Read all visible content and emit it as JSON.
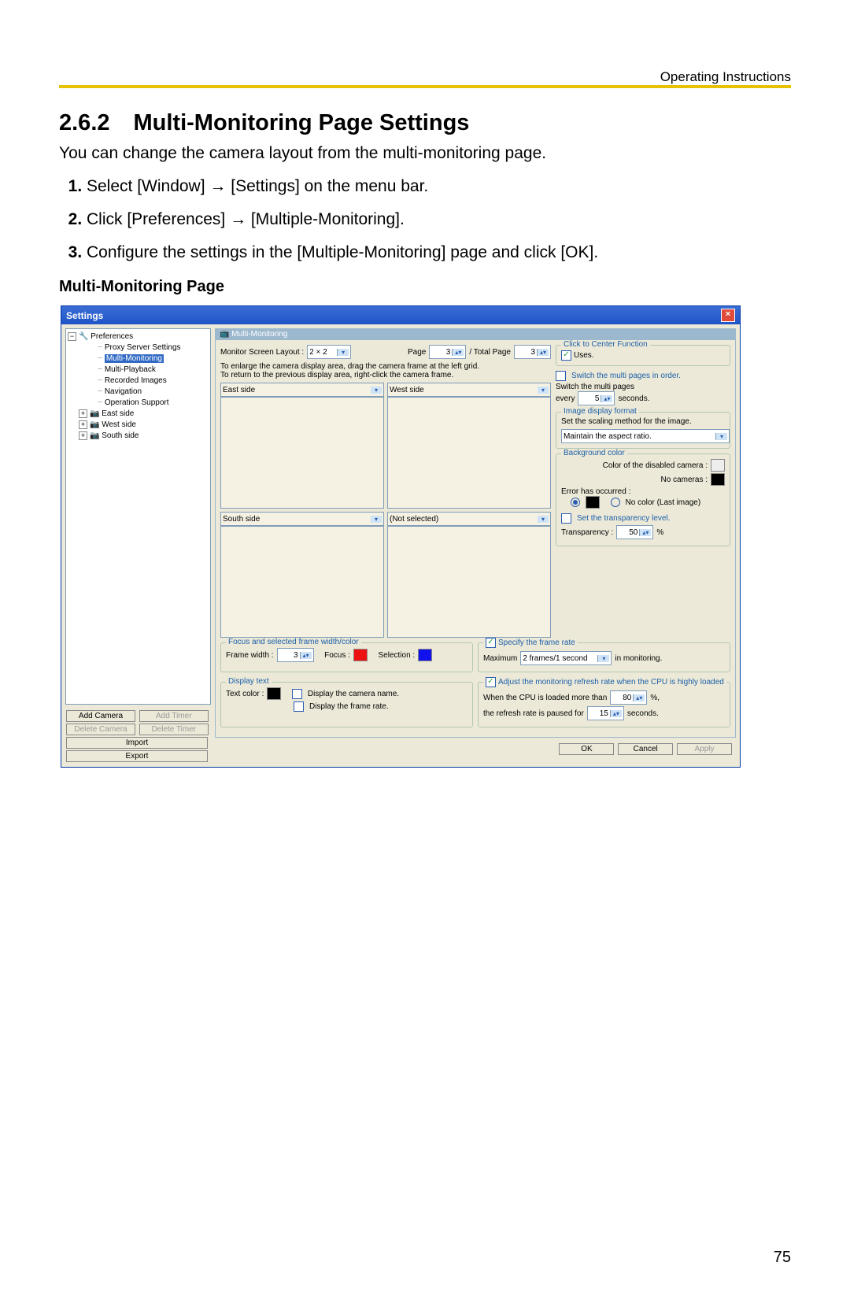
{
  "breadcrumb": "Operating Instructions",
  "section_number": "2.6.2",
  "section_title": "Multi-Monitoring Page Settings",
  "intro": "You can change the camera layout from the multi-monitoring page.",
  "steps": {
    "s1a": "Select [Window]",
    "s1b": "[Settings] on the menu bar.",
    "s2a": "Click [Preferences]",
    "s2b": "[Multiple-Monitoring].",
    "s3": "Configure the settings in the [Multiple-Monitoring] page and click [OK]."
  },
  "sub_title": "Multi-Monitoring Page",
  "page_number": "75",
  "dialog": {
    "title": "Settings",
    "tree": {
      "root": "Preferences",
      "items": [
        "Proxy Server Settings",
        "Multi-Monitoring",
        "Multi-Playback",
        "Recorded Images",
        "Navigation",
        "Operation Support"
      ],
      "cams": [
        "East side",
        "West side",
        "South side"
      ]
    },
    "side_buttons": {
      "add_camera": "Add Camera",
      "add_timer": "Add Timer",
      "delete_camera": "Delete Camera",
      "delete_timer": "Delete Timer",
      "import": "Import",
      "export": "Export"
    },
    "panel_title": "Multi-Monitoring",
    "layout_label": "Monitor Screen Layout :",
    "layout_value": "2 × 2",
    "page_label": "Page",
    "page_value": "3",
    "totalpage_label": "/ Total Page",
    "totalpage_value": "3",
    "hint1": "To enlarge the camera display area, drag the camera frame at the left grid.",
    "hint2": "To return to the previous display area, right-click the camera frame.",
    "cells": [
      "East side",
      "West side",
      "South side",
      "(Not selected)"
    ],
    "center": {
      "legend": "Click to Center Function",
      "uses": "Uses."
    },
    "switch": {
      "label": "Switch the multi pages in order.",
      "line_a": "Switch the multi pages",
      "line_b1": "every",
      "line_val": "5",
      "line_b2": "seconds."
    },
    "imgfmt": {
      "legend": "Image display format",
      "desc": "Set the scaling method for the image.",
      "value": "Maintain the aspect ratio."
    },
    "bg": {
      "legend": "Background color",
      "l1": "Color of the disabled camera :",
      "l2": "No cameras :",
      "l3": "Error has occurred :",
      "nocolor": "No color (Last image)",
      "trans_chk": "Set the transparency level.",
      "trans_lbl": "Transparency :",
      "trans_val": "50",
      "pct": "%"
    },
    "frame": {
      "legend": "Focus and selected frame width/color",
      "width_lbl": "Frame width :",
      "width_val": "3",
      "focus_lbl": "Focus :",
      "sel_lbl": "Selection :"
    },
    "specrate": {
      "legend": "Specify the frame rate",
      "max_lbl": "Maximum",
      "max_val": "2 frames/1 second",
      "tail": "in monitoring."
    },
    "disp": {
      "legend": "Display text",
      "color_lbl": "Text color :",
      "opt1": "Display the camera name.",
      "opt2": "Display the frame rate."
    },
    "adjust": {
      "legend": "Adjust the monitoring refresh rate when the CPU is highly loaded",
      "l1a": "When the CPU is loaded more than",
      "l1v": "80",
      "l1b": "%,",
      "l2a": "the refresh rate is paused for",
      "l2v": "15",
      "l2b": "seconds."
    },
    "buttons": {
      "ok": "OK",
      "cancel": "Cancel",
      "apply": "Apply"
    }
  }
}
